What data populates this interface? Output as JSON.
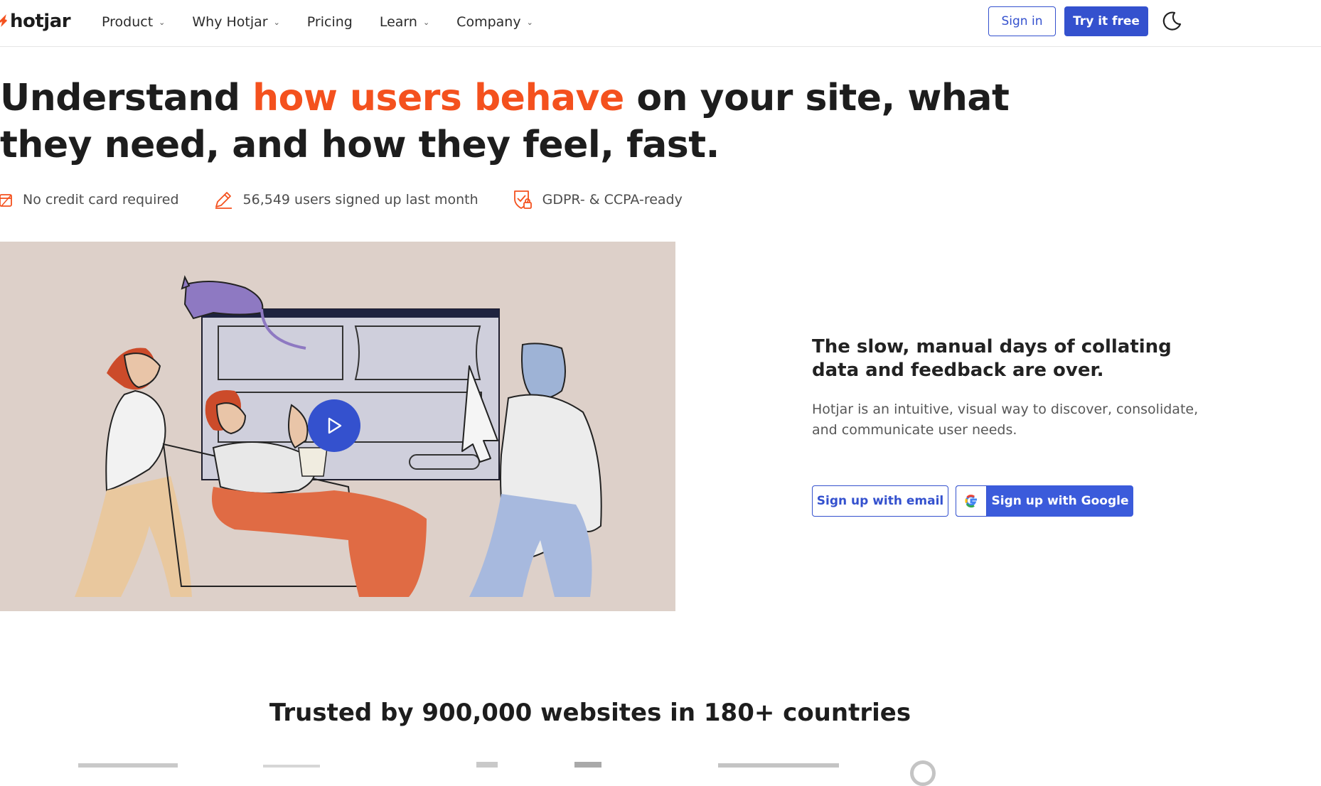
{
  "header": {
    "logo_text": "hotjar",
    "nav": [
      {
        "label": "Product",
        "has_dropdown": true
      },
      {
        "label": "Why Hotjar",
        "has_dropdown": true
      },
      {
        "label": "Pricing",
        "has_dropdown": false
      },
      {
        "label": "Learn",
        "has_dropdown": true
      },
      {
        "label": "Company",
        "has_dropdown": true
      }
    ],
    "sign_in": "Sign in",
    "try_free": "Try it free",
    "theme_icon": "moon-icon"
  },
  "hero": {
    "headline_before": "Understand ",
    "headline_highlight": "how users behave",
    "headline_after": " on your site, what they need, and how they feel, fast.",
    "badges": [
      {
        "icon": "credit-card-icon",
        "text": "No credit card required"
      },
      {
        "icon": "pencil-icon",
        "text": "56,549 users signed up last month"
      },
      {
        "icon": "shield-lock-icon",
        "text": "GDPR- & CCPA-ready"
      }
    ]
  },
  "video": {
    "play_icon": "play-icon"
  },
  "side": {
    "title": "The slow, manual days of collating data and feedback are over.",
    "text": "Hotjar is an intuitive, visual way to discover, consolidate, and communicate user needs.",
    "signup_email": "Sign up with email",
    "signup_google": "Sign up with Google"
  },
  "trusted": {
    "text": "Trusted by 900,000 websites in 180+ countries"
  },
  "colors": {
    "accent": "#f4511e",
    "primary": "#3451ce",
    "video_bg": "#ddd0c9"
  }
}
